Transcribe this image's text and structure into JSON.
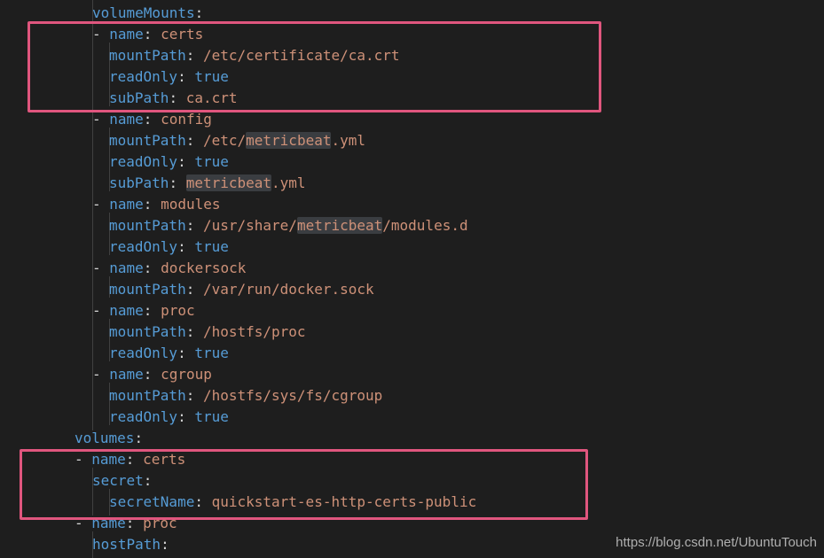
{
  "editor": {
    "lines": [
      {
        "id": "l0",
        "segments": [
          {
            "t": "volumeMounts",
            "c": "key"
          },
          {
            "t": ":",
            "c": "punc"
          }
        ]
      },
      {
        "id": "l1",
        "segments": [
          {
            "t": "- ",
            "c": "dash"
          },
          {
            "t": "name",
            "c": "key"
          },
          {
            "t": ": ",
            "c": "punc"
          },
          {
            "t": "certs",
            "c": "str"
          }
        ]
      },
      {
        "id": "l2",
        "segments": [
          {
            "t": "mountPath",
            "c": "key"
          },
          {
            "t": ": ",
            "c": "punc"
          },
          {
            "t": "/etc/certificate/ca.crt",
            "c": "str"
          }
        ]
      },
      {
        "id": "l3",
        "segments": [
          {
            "t": "readOnly",
            "c": "key"
          },
          {
            "t": ": ",
            "c": "punc"
          },
          {
            "t": "true",
            "c": "bool"
          }
        ]
      },
      {
        "id": "l4",
        "segments": [
          {
            "t": "subPath",
            "c": "key"
          },
          {
            "t": ": ",
            "c": "punc"
          },
          {
            "t": "ca.crt",
            "c": "str"
          }
        ]
      },
      {
        "id": "l5",
        "segments": [
          {
            "t": "- ",
            "c": "dash"
          },
          {
            "t": "name",
            "c": "key"
          },
          {
            "t": ": ",
            "c": "punc"
          },
          {
            "t": "config",
            "c": "str"
          }
        ]
      },
      {
        "id": "l6",
        "segments": [
          {
            "t": "mountPath",
            "c": "key"
          },
          {
            "t": ": ",
            "c": "punc"
          },
          {
            "t": "/etc/",
            "c": "str"
          },
          {
            "t": "metricbeat",
            "c": "str hl"
          },
          {
            "t": ".yml",
            "c": "str"
          }
        ]
      },
      {
        "id": "l7",
        "segments": [
          {
            "t": "readOnly",
            "c": "key"
          },
          {
            "t": ": ",
            "c": "punc"
          },
          {
            "t": "true",
            "c": "bool"
          }
        ]
      },
      {
        "id": "l8",
        "segments": [
          {
            "t": "subPath",
            "c": "key"
          },
          {
            "t": ": ",
            "c": "punc"
          },
          {
            "t": "metricbeat",
            "c": "str hl"
          },
          {
            "t": ".yml",
            "c": "str"
          }
        ]
      },
      {
        "id": "l9",
        "segments": [
          {
            "t": "- ",
            "c": "dash"
          },
          {
            "t": "name",
            "c": "key"
          },
          {
            "t": ": ",
            "c": "punc"
          },
          {
            "t": "modules",
            "c": "str"
          }
        ]
      },
      {
        "id": "l10",
        "segments": [
          {
            "t": "mountPath",
            "c": "key"
          },
          {
            "t": ": ",
            "c": "punc"
          },
          {
            "t": "/usr/share/",
            "c": "str"
          },
          {
            "t": "metricbeat",
            "c": "str hl"
          },
          {
            "t": "/modules.d",
            "c": "str"
          }
        ]
      },
      {
        "id": "l11",
        "segments": [
          {
            "t": "readOnly",
            "c": "key"
          },
          {
            "t": ": ",
            "c": "punc"
          },
          {
            "t": "true",
            "c": "bool"
          }
        ]
      },
      {
        "id": "l12",
        "segments": [
          {
            "t": "- ",
            "c": "dash"
          },
          {
            "t": "name",
            "c": "key"
          },
          {
            "t": ": ",
            "c": "punc"
          },
          {
            "t": "dockersock",
            "c": "str"
          }
        ]
      },
      {
        "id": "l13",
        "segments": [
          {
            "t": "mountPath",
            "c": "key"
          },
          {
            "t": ": ",
            "c": "punc"
          },
          {
            "t": "/var/run/docker.sock",
            "c": "str"
          }
        ]
      },
      {
        "id": "l14",
        "segments": [
          {
            "t": "- ",
            "c": "dash"
          },
          {
            "t": "name",
            "c": "key"
          },
          {
            "t": ": ",
            "c": "punc"
          },
          {
            "t": "proc",
            "c": "str"
          }
        ]
      },
      {
        "id": "l15",
        "segments": [
          {
            "t": "mountPath",
            "c": "key"
          },
          {
            "t": ": ",
            "c": "punc"
          },
          {
            "t": "/hostfs/proc",
            "c": "str"
          }
        ]
      },
      {
        "id": "l16",
        "segments": [
          {
            "t": "readOnly",
            "c": "key"
          },
          {
            "t": ": ",
            "c": "punc"
          },
          {
            "t": "true",
            "c": "bool"
          }
        ]
      },
      {
        "id": "l17",
        "segments": [
          {
            "t": "- ",
            "c": "dash"
          },
          {
            "t": "name",
            "c": "key"
          },
          {
            "t": ": ",
            "c": "punc"
          },
          {
            "t": "cgroup",
            "c": "str"
          }
        ]
      },
      {
        "id": "l18",
        "segments": [
          {
            "t": "mountPath",
            "c": "key"
          },
          {
            "t": ": ",
            "c": "punc"
          },
          {
            "t": "/hostfs/sys/fs/cgroup",
            "c": "str"
          }
        ]
      },
      {
        "id": "l19",
        "segments": [
          {
            "t": "readOnly",
            "c": "key"
          },
          {
            "t": ": ",
            "c": "punc"
          },
          {
            "t": "true",
            "c": "bool"
          }
        ]
      },
      {
        "id": "l20",
        "segments": [
          {
            "t": "volumes",
            "c": "key"
          },
          {
            "t": ":",
            "c": "punc"
          }
        ]
      },
      {
        "id": "l21",
        "segments": [
          {
            "t": "- ",
            "c": "dash"
          },
          {
            "t": "name",
            "c": "key"
          },
          {
            "t": ": ",
            "c": "punc"
          },
          {
            "t": "certs",
            "c": "str"
          }
        ]
      },
      {
        "id": "l22",
        "segments": [
          {
            "t": "secret",
            "c": "key"
          },
          {
            "t": ":",
            "c": "punc"
          }
        ]
      },
      {
        "id": "l23",
        "segments": [
          {
            "t": "secretName",
            "c": "key"
          },
          {
            "t": ": ",
            "c": "punc"
          },
          {
            "t": "quickstart-es-http-certs-public",
            "c": "str"
          }
        ]
      },
      {
        "id": "l24",
        "segments": [
          {
            "t": "- ",
            "c": "dash"
          },
          {
            "t": "name",
            "c": "key"
          },
          {
            "t": ": ",
            "c": "punc"
          },
          {
            "t": "proc",
            "c": "str"
          }
        ]
      },
      {
        "id": "l25",
        "segments": [
          {
            "t": "hostPath",
            "c": "key"
          },
          {
            "t": ":",
            "c": "punc"
          }
        ]
      }
    ]
  },
  "colors": {
    "background": "#1e1e1e",
    "key": "#569cd6",
    "string": "#ce9178",
    "highlight_box": "#e0567e"
  },
  "watermark": "https://blog.csdn.net/UbuntuTouch"
}
